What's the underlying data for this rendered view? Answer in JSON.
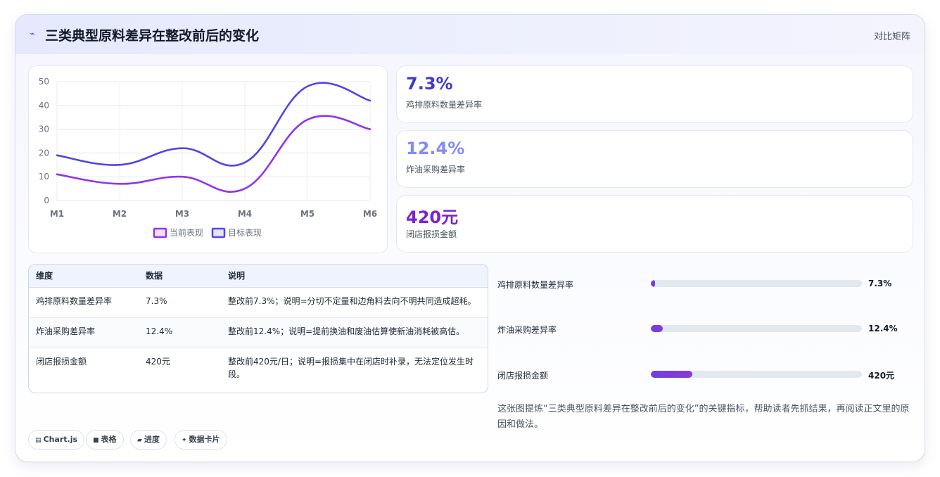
{
  "header": {
    "icon": "bolt-icon",
    "title": "三类典型原料差异在整改前后的变化",
    "right_label": "对比矩阵"
  },
  "chart_data": {
    "type": "line",
    "categories": [
      "M1",
      "M2",
      "M3",
      "M4",
      "M5",
      "M6"
    ],
    "series": [
      {
        "name": "当前表现",
        "values": [
          11,
          7,
          10,
          5,
          34,
          30
        ],
        "color": "#9333ea"
      },
      {
        "name": "目标表现",
        "values": [
          19,
          15,
          22,
          16,
          48,
          42
        ],
        "color": "#4f46e5"
      }
    ],
    "ylim": [
      0,
      50
    ],
    "yticks": [
      0,
      10,
      20,
      30,
      40,
      50
    ],
    "grid": true,
    "legend": "bottom"
  },
  "stats": [
    {
      "value": "7.3%",
      "label": "鸡排原料数量差异率",
      "color": "#4338ca"
    },
    {
      "value": "12.4%",
      "label": "炸油采购差异率",
      "color": "#818cf8"
    },
    {
      "value": "420元",
      "label": "闭店报损金额",
      "color": "#7e22ce"
    }
  ],
  "table": {
    "headers": [
      "维度",
      "数据",
      "说明"
    ],
    "rows": [
      [
        "鸡排原料数量差异率",
        "7.3%",
        "整改前7.3%；说明=分切不定量和边角料去向不明共同造成超耗。"
      ],
      [
        "炸油采购差异率",
        "12.4%",
        "整改前12.4%；说明=提前换油和废油估算使新油消耗被高估。"
      ],
      [
        "闭店报损金额",
        "420元",
        "整改前420元/日；说明=报损集中在闭店时补录，无法定位发生时段。"
      ]
    ]
  },
  "progress": [
    {
      "label": "鸡排原料数量差异率",
      "value": "7.3%",
      "fraction": 0.02
    },
    {
      "label": "炸油采购差异率",
      "value": "12.4%",
      "fraction": 0.055
    },
    {
      "label": "闭店报损金额",
      "value": "420元",
      "fraction": 0.195
    }
  ],
  "summary": "这张图提炼“三类典型原料差异在整改前后的变化”的关键指标，帮助读者先抓结果，再阅读正文里的原因和做法。",
  "tags": [
    {
      "icon": "chart-icon",
      "glyph": "▤",
      "label": "Chart.js"
    },
    {
      "icon": "table-icon",
      "glyph": "■",
      "label": "表格"
    },
    {
      "icon": "progress-icon",
      "glyph": "▰",
      "label": "进度"
    },
    {
      "icon": "sparkle-icon",
      "glyph": "✦",
      "label": "数据卡片"
    }
  ]
}
